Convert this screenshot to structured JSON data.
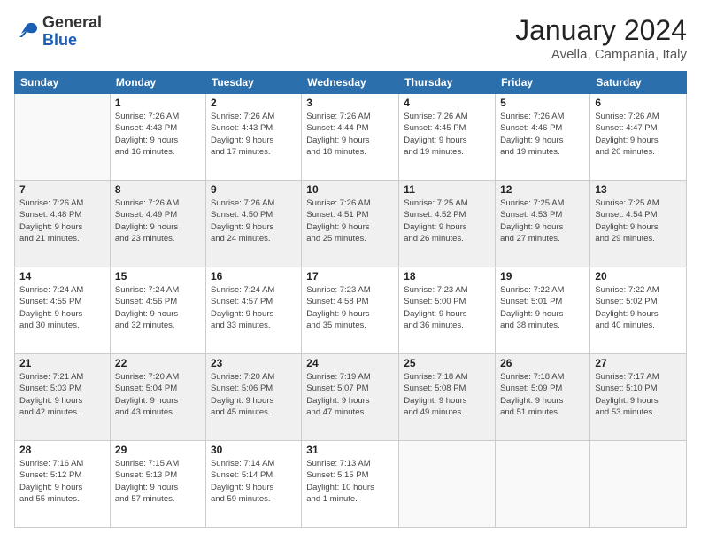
{
  "header": {
    "logo_general": "General",
    "logo_blue": "Blue",
    "month_title": "January 2024",
    "location": "Avella, Campania, Italy"
  },
  "columns": [
    "Sunday",
    "Monday",
    "Tuesday",
    "Wednesday",
    "Thursday",
    "Friday",
    "Saturday"
  ],
  "weeks": [
    [
      {
        "num": "",
        "info": ""
      },
      {
        "num": "1",
        "info": "Sunrise: 7:26 AM\nSunset: 4:43 PM\nDaylight: 9 hours\nand 16 minutes."
      },
      {
        "num": "2",
        "info": "Sunrise: 7:26 AM\nSunset: 4:43 PM\nDaylight: 9 hours\nand 17 minutes."
      },
      {
        "num": "3",
        "info": "Sunrise: 7:26 AM\nSunset: 4:44 PM\nDaylight: 9 hours\nand 18 minutes."
      },
      {
        "num": "4",
        "info": "Sunrise: 7:26 AM\nSunset: 4:45 PM\nDaylight: 9 hours\nand 19 minutes."
      },
      {
        "num": "5",
        "info": "Sunrise: 7:26 AM\nSunset: 4:46 PM\nDaylight: 9 hours\nand 19 minutes."
      },
      {
        "num": "6",
        "info": "Sunrise: 7:26 AM\nSunset: 4:47 PM\nDaylight: 9 hours\nand 20 minutes."
      }
    ],
    [
      {
        "num": "7",
        "info": "Sunrise: 7:26 AM\nSunset: 4:48 PM\nDaylight: 9 hours\nand 21 minutes."
      },
      {
        "num": "8",
        "info": "Sunrise: 7:26 AM\nSunset: 4:49 PM\nDaylight: 9 hours\nand 23 minutes."
      },
      {
        "num": "9",
        "info": "Sunrise: 7:26 AM\nSunset: 4:50 PM\nDaylight: 9 hours\nand 24 minutes."
      },
      {
        "num": "10",
        "info": "Sunrise: 7:26 AM\nSunset: 4:51 PM\nDaylight: 9 hours\nand 25 minutes."
      },
      {
        "num": "11",
        "info": "Sunrise: 7:25 AM\nSunset: 4:52 PM\nDaylight: 9 hours\nand 26 minutes."
      },
      {
        "num": "12",
        "info": "Sunrise: 7:25 AM\nSunset: 4:53 PM\nDaylight: 9 hours\nand 27 minutes."
      },
      {
        "num": "13",
        "info": "Sunrise: 7:25 AM\nSunset: 4:54 PM\nDaylight: 9 hours\nand 29 minutes."
      }
    ],
    [
      {
        "num": "14",
        "info": "Sunrise: 7:24 AM\nSunset: 4:55 PM\nDaylight: 9 hours\nand 30 minutes."
      },
      {
        "num": "15",
        "info": "Sunrise: 7:24 AM\nSunset: 4:56 PM\nDaylight: 9 hours\nand 32 minutes."
      },
      {
        "num": "16",
        "info": "Sunrise: 7:24 AM\nSunset: 4:57 PM\nDaylight: 9 hours\nand 33 minutes."
      },
      {
        "num": "17",
        "info": "Sunrise: 7:23 AM\nSunset: 4:58 PM\nDaylight: 9 hours\nand 35 minutes."
      },
      {
        "num": "18",
        "info": "Sunrise: 7:23 AM\nSunset: 5:00 PM\nDaylight: 9 hours\nand 36 minutes."
      },
      {
        "num": "19",
        "info": "Sunrise: 7:22 AM\nSunset: 5:01 PM\nDaylight: 9 hours\nand 38 minutes."
      },
      {
        "num": "20",
        "info": "Sunrise: 7:22 AM\nSunset: 5:02 PM\nDaylight: 9 hours\nand 40 minutes."
      }
    ],
    [
      {
        "num": "21",
        "info": "Sunrise: 7:21 AM\nSunset: 5:03 PM\nDaylight: 9 hours\nand 42 minutes."
      },
      {
        "num": "22",
        "info": "Sunrise: 7:20 AM\nSunset: 5:04 PM\nDaylight: 9 hours\nand 43 minutes."
      },
      {
        "num": "23",
        "info": "Sunrise: 7:20 AM\nSunset: 5:06 PM\nDaylight: 9 hours\nand 45 minutes."
      },
      {
        "num": "24",
        "info": "Sunrise: 7:19 AM\nSunset: 5:07 PM\nDaylight: 9 hours\nand 47 minutes."
      },
      {
        "num": "25",
        "info": "Sunrise: 7:18 AM\nSunset: 5:08 PM\nDaylight: 9 hours\nand 49 minutes."
      },
      {
        "num": "26",
        "info": "Sunrise: 7:18 AM\nSunset: 5:09 PM\nDaylight: 9 hours\nand 51 minutes."
      },
      {
        "num": "27",
        "info": "Sunrise: 7:17 AM\nSunset: 5:10 PM\nDaylight: 9 hours\nand 53 minutes."
      }
    ],
    [
      {
        "num": "28",
        "info": "Sunrise: 7:16 AM\nSunset: 5:12 PM\nDaylight: 9 hours\nand 55 minutes."
      },
      {
        "num": "29",
        "info": "Sunrise: 7:15 AM\nSunset: 5:13 PM\nDaylight: 9 hours\nand 57 minutes."
      },
      {
        "num": "30",
        "info": "Sunrise: 7:14 AM\nSunset: 5:14 PM\nDaylight: 9 hours\nand 59 minutes."
      },
      {
        "num": "31",
        "info": "Sunrise: 7:13 AM\nSunset: 5:15 PM\nDaylight: 10 hours\nand 1 minute."
      },
      {
        "num": "",
        "info": ""
      },
      {
        "num": "",
        "info": ""
      },
      {
        "num": "",
        "info": ""
      }
    ]
  ]
}
